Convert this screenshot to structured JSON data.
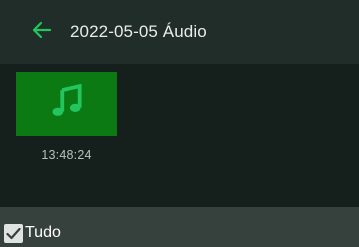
{
  "header": {
    "title": "2022-05-05 Áudio",
    "back_icon": "arrow-left-icon",
    "back_icon_color": "#22c55e"
  },
  "files": [
    {
      "icon": "music-note-icon",
      "icon_color": "#22c55e",
      "thumbnail_color": "#0b7a12",
      "time": "13:48:24"
    }
  ],
  "footer": {
    "select_all_label": "Tudo",
    "select_all_checked": true
  }
}
